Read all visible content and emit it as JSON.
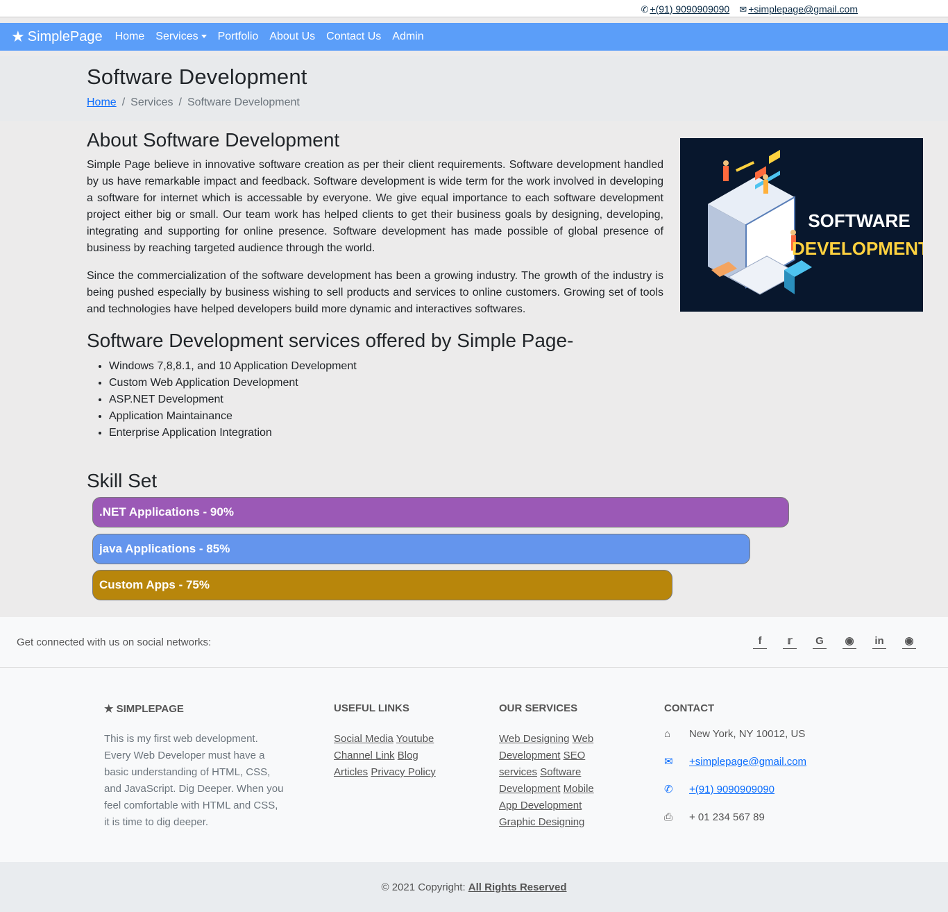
{
  "topbar": {
    "phone": "+(91) 9090909090",
    "email": "+simplepage@gmail.com",
    "phone_icon": "phone-icon",
    "email_icon": "envelope-icon"
  },
  "nav": {
    "brand": "SimplePage",
    "brand_icon": "star-icon",
    "items": [
      "Home",
      "Services",
      "Portfolio",
      "About Us",
      "Contact Us",
      "Admin"
    ]
  },
  "hero": {
    "title": "Software Development",
    "breadcrumb": [
      "Home",
      "Services",
      "Software Development"
    ]
  },
  "about": {
    "heading": "About Software Development",
    "p1": "Simple Page believe in innovative software creation as per their client requirements. Software development handled by us have remarkable impact and feedback. Software development is wide term for the work involved in developing a software for internet which is accessable by everyone. We give equal importance to each software development project either big or small. Our team work has helped clients to get their business goals by designing, developing, integrating and supporting for online presence. Software development has made possible of global presence of business by reaching targeted audience through the world.",
    "p2": "Since the commercialization of the software development has been a growing industry. The growth of the industry is being pushed especially by business wishing to sell products and services to online customers. Growing set of tools and technologies have helped developers build more dynamic and interactives softwares.",
    "image_text": [
      "SOFTWARE",
      "DEVELOPMENT"
    ]
  },
  "services": {
    "heading": "Software Development services offered by Simple Page-",
    "items": [
      "Windows 7,8,8.1, and 10 Application Development",
      "Custom Web Application Development",
      "ASP.NET Development",
      "Application Maintainance",
      "Enterprise Application Integration"
    ]
  },
  "skills": {
    "heading": "Skill Set",
    "bars": [
      {
        "label": ".NET Applications - 90%",
        "percent": 90,
        "color": "#9b59b6"
      },
      {
        "label": "java Applications - 85%",
        "percent": 85,
        "color": "#6495ed"
      },
      {
        "label": "Custom Apps - 75%",
        "percent": 75,
        "color": "#b8860b"
      }
    ]
  },
  "social": {
    "text": "Get connected with us on social networks:",
    "icons": [
      "facebook-icon",
      "twitter-icon",
      "google-icon",
      "instagram-icon",
      "linkedin-icon",
      "github-icon"
    ]
  },
  "footer": {
    "brand": "SIMPLEPAGE",
    "about": "This is my first web development. Every Web Developer must have a basic understanding of HTML, CSS, and JavaScript. Dig Deeper. When you feel comfortable with HTML and CSS, it is time to dig deeper.",
    "useful_heading": "USEFUL LINKS",
    "useful_links": [
      "Social Media",
      "Youtube Channel Link",
      "Blog Articles",
      "Privacy Policy"
    ],
    "services_heading": "OUR SERVICES",
    "service_links": [
      "Web Designing",
      "Web Development",
      "SEO services",
      "Software Development",
      "Mobile App Development",
      "Graphic Designing"
    ],
    "contact_heading": "CONTACT",
    "address": "New York, NY 10012, US",
    "email": "+simplepage@gmail.com",
    "phone": "+(91) 9090909090",
    "fax": "+ 01 234 567 89"
  },
  "copyright": {
    "text": "© 2021 Copyright:",
    "link": "All Rights Reserved"
  }
}
